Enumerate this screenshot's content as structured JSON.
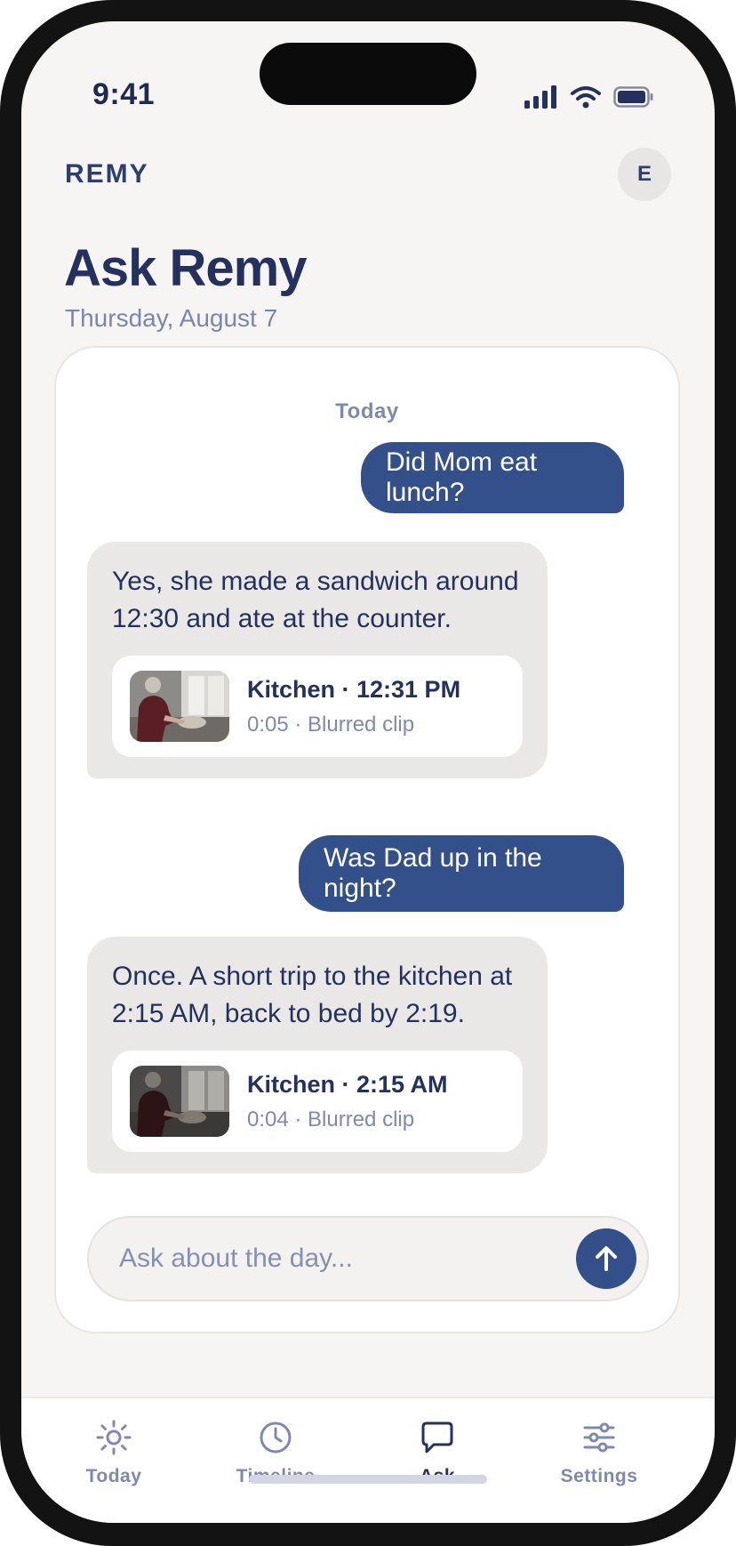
{
  "status_bar": {
    "time": "9:41"
  },
  "header": {
    "brand": "REMY",
    "avatar_initial": "E",
    "title": "Ask Remy",
    "date": "Thursday, August 7"
  },
  "chat": {
    "day_label": "Today",
    "messages": [
      {
        "role": "user",
        "text": "Did Mom eat lunch?"
      },
      {
        "role": "assistant",
        "text": "Yes, she made a sandwich around 12:30 and ate at the counter.",
        "clip": {
          "title": "Kitchen · 12:31 PM",
          "subtitle": "0:05 · Blurred clip"
        }
      },
      {
        "role": "user",
        "text": "Was Dad up in the night?"
      },
      {
        "role": "assistant",
        "text": "Once. A short trip to the kitchen at 2:15 AM, back to bed by 2:19.",
        "clip": {
          "title": "Kitchen · 2:15 AM",
          "subtitle": "0:04 · Blurred clip"
        }
      }
    ]
  },
  "composer": {
    "placeholder": "Ask about the day..."
  },
  "tab_bar": {
    "items": [
      {
        "label": "Today",
        "icon": "sun-icon",
        "active": false
      },
      {
        "label": "Timeline",
        "icon": "clock-icon",
        "active": false
      },
      {
        "label": "Ask",
        "icon": "chat-bubble-icon",
        "active": true
      },
      {
        "label": "Settings",
        "icon": "sliders-icon",
        "active": false
      }
    ]
  },
  "colors": {
    "accent": "#33508a",
    "text_primary": "#24315e",
    "text_muted": "#7f89ad",
    "background": "#f6f5f4"
  }
}
